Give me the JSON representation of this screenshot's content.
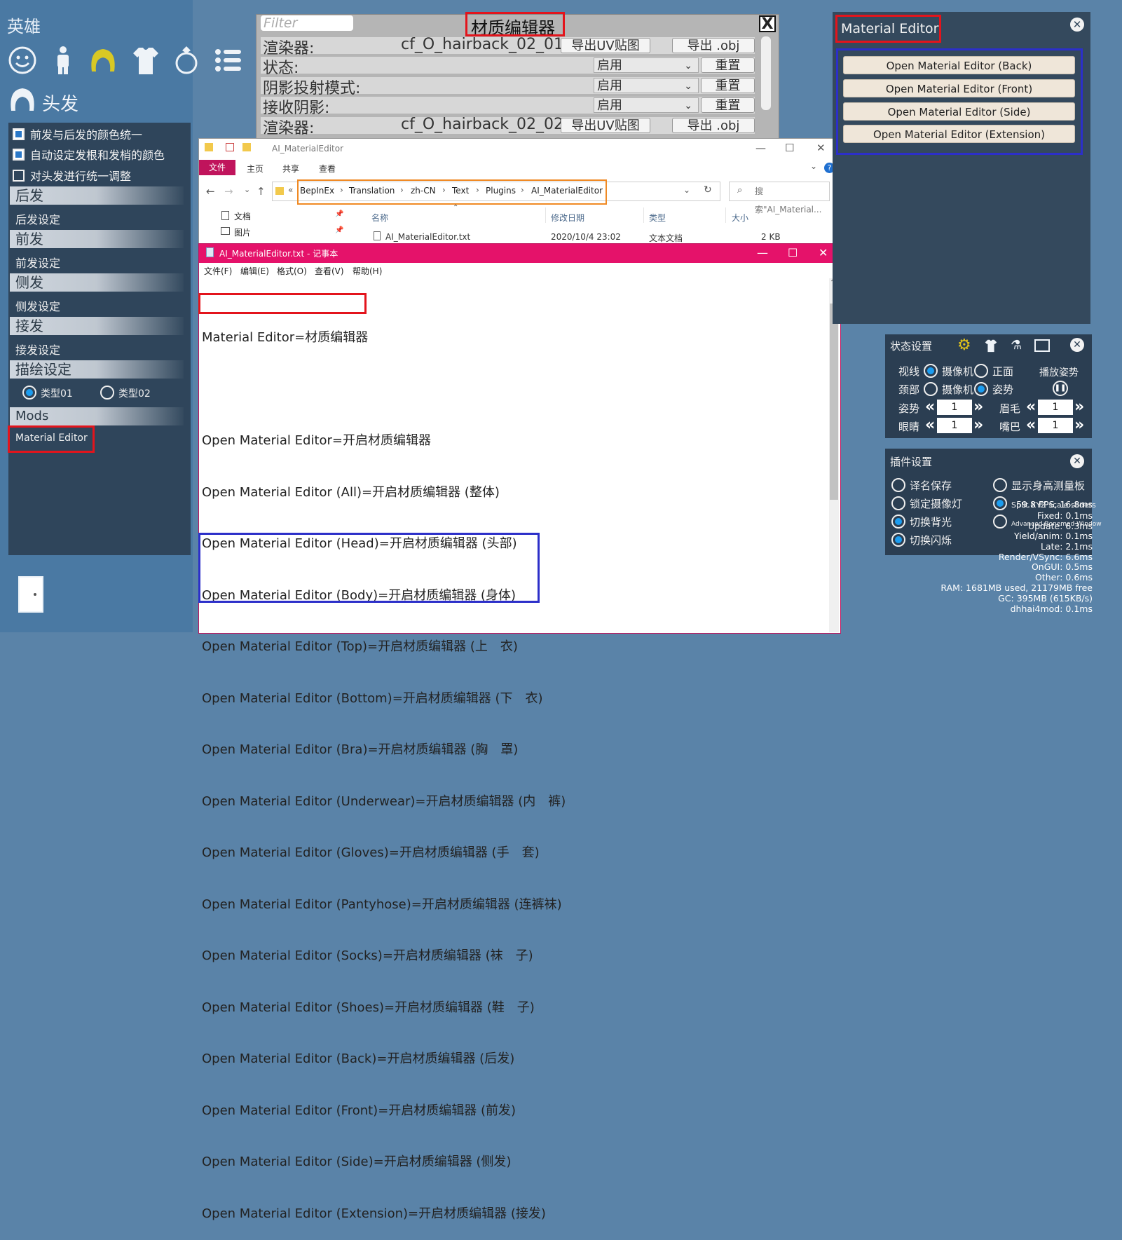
{
  "left_panel": {
    "hero_title": "英雄",
    "hair_title": "头发",
    "checkboxes": [
      {
        "label": "前发与后发的颜色统一",
        "checked": true
      },
      {
        "label": "自动设定发根和发梢的颜色",
        "checked": true
      },
      {
        "label": "对头发进行统一调整",
        "checked": false
      }
    ],
    "sections": [
      {
        "header": "后发",
        "item": "后发设定"
      },
      {
        "header": "前发",
        "item": "前发设定"
      },
      {
        "header": "侧发",
        "item": "侧发设定"
      },
      {
        "header": "接发",
        "item": "接发设定"
      }
    ],
    "draw_header": "描绘设定",
    "draw_options": [
      "类型01",
      "类型02"
    ],
    "mods_header": "Mods",
    "mods_item": "Material Editor"
  },
  "material_editor_window": {
    "filter_placeholder": "Filter",
    "title": "材质编辑器",
    "close": "X",
    "rows": [
      {
        "label": "渲染器:",
        "value": "cf_O_hairback_02_01",
        "btn1": "导出UV贴图",
        "btn2": "导出 .obj"
      },
      {
        "label": "状态:",
        "dropdown": "启用",
        "btn2": "重置"
      },
      {
        "label": "阴影投射模式:",
        "dropdown": "启用",
        "btn2": "重置"
      },
      {
        "label": "接收阴影:",
        "dropdown": "启用",
        "btn2": "重置"
      },
      {
        "label": "渲染器:",
        "value": "cf_O_hairback_02_02",
        "btn1": "导出UV贴图",
        "btn2": "导出 .obj"
      }
    ]
  },
  "explorer": {
    "title": "AI_MaterialEditor",
    "ribbon_tabs": [
      "文件",
      "主页",
      "共享",
      "查看"
    ],
    "breadcrumb": [
      "BepInEx",
      "Translation",
      "zh-CN",
      "Text",
      "Plugins",
      "AI_MaterialEditor"
    ],
    "search_placeholder": "搜索\"AI_Material...",
    "nav_items": [
      "文档",
      "图片"
    ],
    "columns": [
      "名称",
      "修改日期",
      "类型",
      "大小"
    ],
    "file": {
      "name": "AI_MaterialEditor.txt",
      "date": "2020/10/4 23:02",
      "type": "文本文档",
      "size": "2 KB"
    }
  },
  "notepad": {
    "title": "AI_MaterialEditor.txt - 记事本",
    "menu": [
      "文件(F)",
      "编辑(E)",
      "格式(O)",
      "查看(V)",
      "帮助(H)"
    ],
    "lines": [
      "Material Editor=材质编辑器",
      "",
      "Open Material Editor=开启材质编辑器",
      "Open Material Editor (All)=开启材质编辑器 (整体)",
      "Open Material Editor (Head)=开启材质编辑器 (头部)",
      "Open Material Editor (Body)=开启材质编辑器 (身体)",
      "Open Material Editor (Top)=开启材质编辑器 (上　衣)",
      "Open Material Editor (Bottom)=开启材质编辑器 (下　衣)",
      "Open Material Editor (Bra)=开启材质编辑器 (胸　罩)",
      "Open Material Editor (Underwear)=开启材质编辑器 (内　裤)",
      "Open Material Editor (Gloves)=开启材质编辑器 (手　套)",
      "Open Material Editor (Pantyhose)=开启材质编辑器 (连裤袜)",
      "Open Material Editor (Socks)=开启材质编辑器 (袜　子)",
      "Open Material Editor (Shoes)=开启材质编辑器 (鞋　子)",
      "Open Material Editor (Back)=开启材质编辑器 (后发)",
      "Open Material Editor (Front)=开启材质编辑器 (前发)",
      "Open Material Editor (Side)=开启材质编辑器 (侧发)",
      "Open Material Editor (Extension)=开启材质编辑器 (接发)"
    ]
  },
  "right_panel": {
    "title": "Material Editor",
    "close": "✕",
    "buttons": [
      "Open Material Editor (Back)",
      "Open Material Editor (Front)",
      "Open Material Editor (Side)",
      "Open Material Editor (Extension)"
    ]
  },
  "state_settings": {
    "title": "状态设置",
    "gaze_label": "视线",
    "gaze_options": [
      "摄像机",
      "正面"
    ],
    "neck_label": "颈部",
    "neck_options": [
      "摄像机",
      "姿势"
    ],
    "play_pose": "播放姿势",
    "pose_label": "姿势",
    "pose_value": "1",
    "eyebrow_label": "眉毛",
    "eyebrow_value": "1",
    "eyes_label": "眼睛",
    "eyes_value": "1",
    "mouth_label": "嘴巴",
    "mouth_value": "1"
  },
  "plugin_settings": {
    "title": "插件设置",
    "options": [
      {
        "label": "译名保存",
        "on": false
      },
      {
        "label": "显示身高测量板",
        "on": false
      },
      {
        "label": "锁定摄像灯",
        "on": false
      },
      {
        "label": "Split XYZ scale sliders",
        "on": true
      },
      {
        "label": "切换背光",
        "on": true
      },
      {
        "label": "Advanced Bonemod Window",
        "on": false
      },
      {
        "label": "切换闪烁",
        "on": true
      }
    ]
  },
  "debug": {
    "lines": [
      "59.8 FPS, 16.8ms",
      "Fixed:  0.1ms",
      "Update:  6.3ms",
      "Yield/anim:  0.1ms",
      "Late:  2.1ms",
      "Render/VSync:  6.6ms",
      "OnGUI:  0.5ms",
      "Other:  0.6ms",
      "RAM: 1681MB used, 21179MB free",
      "GC: 395MB (615KB/s)",
      "dhhai4mod: 0.1ms"
    ]
  },
  "colors": {
    "highlight_red": "#e3141c",
    "highlight_blue": "#2c2fc9",
    "highlight_orange": "#f08a24",
    "notepad_accent": "#e5126a"
  }
}
